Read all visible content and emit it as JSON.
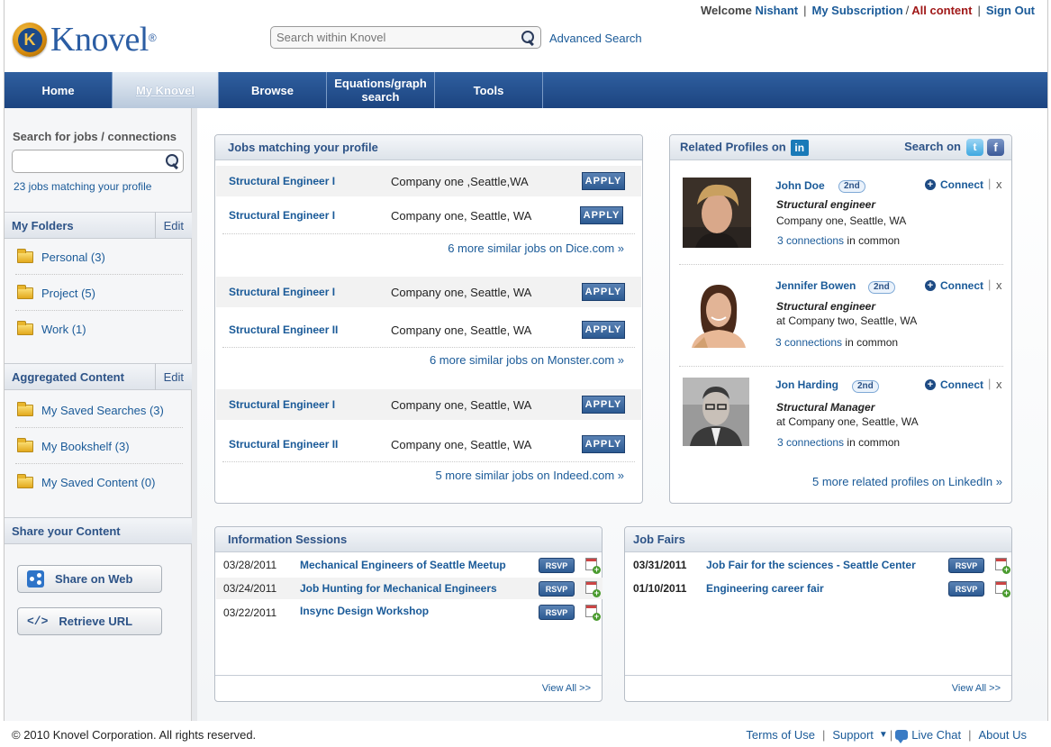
{
  "header": {
    "logo_text": "Knovel",
    "logo_mark": "K",
    "logo_reg": "®",
    "search_placeholder": "Search within Knovel",
    "advanced_search": "Advanced Search",
    "welcome_label": "Welcome",
    "user_name": "Nishant",
    "my_subscription": "My Subscription",
    "slash": "/",
    "all_content": "All content",
    "sign_out": "Sign Out",
    "sep": "|"
  },
  "nav": {
    "tabs": [
      {
        "label": "Home"
      },
      {
        "label": "My Knovel"
      },
      {
        "label": "Browse"
      },
      {
        "label": "Equations/graph search"
      },
      {
        "label": "Tools"
      }
    ],
    "active_index": 1
  },
  "sidebar": {
    "search_label": "Search for jobs / connections",
    "jobs_link": "23 jobs matching your profile",
    "folders_title": "My Folders",
    "edit_label": "Edit",
    "folders": [
      {
        "label": "Personal (3)"
      },
      {
        "label": "Project (5)"
      },
      {
        "label": "Work (1)"
      }
    ],
    "aggregated_title": "Aggregated Content",
    "aggregated": [
      {
        "label": "My Saved Searches (3)"
      },
      {
        "label": "My Bookshelf (3)"
      },
      {
        "label": "My Saved Content (0)"
      }
    ],
    "share_title": "Share your Content",
    "share_web": "Share on Web",
    "retrieve_url": "Retrieve URL",
    "retrieve_icon_glyph": "</>"
  },
  "jobs": {
    "title": "Jobs matching your profile",
    "apply_label": "APPLY",
    "groups": [
      {
        "rows": [
          {
            "title": "Structural Engineer I",
            "company": "Company one ,Seattle,WA"
          },
          {
            "title": "Structural Engineer I",
            "company": "Company one, Seattle, WA"
          }
        ],
        "more": "6 more similar jobs on Dice.com »"
      },
      {
        "rows": [
          {
            "title": "Structural Engineer I",
            "company": "Company one, Seattle, WA"
          },
          {
            "title": "Structural Engineer II",
            "company": "Company one, Seattle, WA"
          }
        ],
        "more": "6 more similar jobs on Monster.com »"
      },
      {
        "rows": [
          {
            "title": "Structural Engineer I",
            "company": "Company one, Seattle, WA"
          },
          {
            "title": "Structural Engineer II",
            "company": "Company one, Seattle, WA"
          }
        ],
        "more": "5 more similar jobs on Indeed.com »"
      }
    ]
  },
  "profiles": {
    "title": "Related Profiles on",
    "linkedin_glyph": "in",
    "search_on": "Search on",
    "twitter_glyph": "t",
    "facebook_glyph": "f",
    "connect_label": "Connect",
    "plus_glyph": "+",
    "close_glyph": "x",
    "connections_suffix": "in common",
    "people": [
      {
        "name": "John Doe",
        "degree": "2nd",
        "title": "Structural engineer",
        "location": "Company one, Seattle, WA",
        "connections": "3 connections"
      },
      {
        "name": "Jennifer Bowen",
        "degree": "2nd",
        "title": "Structural engineer",
        "location": "at Company two, Seattle, WA",
        "connections": "3 connections"
      },
      {
        "name": "Jon Harding",
        "degree": "2nd",
        "title": "Structural Manager",
        "location": "at Company one, Seattle, WA",
        "connections": "3 connections"
      }
    ],
    "more": "5 more related profiles on LinkedIn »"
  },
  "info_sessions": {
    "title": "Information Sessions",
    "rsvp_label": "RSVP",
    "view_all": "View All >>",
    "rows": [
      {
        "date": "03/28/2011",
        "title": "Mechanical Engineers of Seattle Meetup"
      },
      {
        "date": "03/24/2011",
        "title": "Job Hunting for Mechanical Engineers"
      },
      {
        "date": "03/22/2011",
        "title": "Insync Design Workshop"
      }
    ]
  },
  "job_fairs": {
    "title": "Job Fairs",
    "rsvp_label": "RSVP",
    "view_all": "View All >>",
    "rows": [
      {
        "date": "03/31/2011",
        "title": "Job Fair for the sciences - Seattle Center"
      },
      {
        "date": "01/10/2011",
        "title": "Engineering career fair"
      }
    ]
  },
  "footer": {
    "copyright": "© 2010 Knovel Corporation. All rights reserved.",
    "terms": "Terms of Use",
    "support": "Support",
    "live_chat": "Live Chat",
    "about": "About Us",
    "sep": "|"
  },
  "colors": {
    "nav_blue": "#1c4480",
    "link_blue": "#1a5a98",
    "heading_blue": "#2d5387",
    "all_content_red": "#a01818"
  }
}
